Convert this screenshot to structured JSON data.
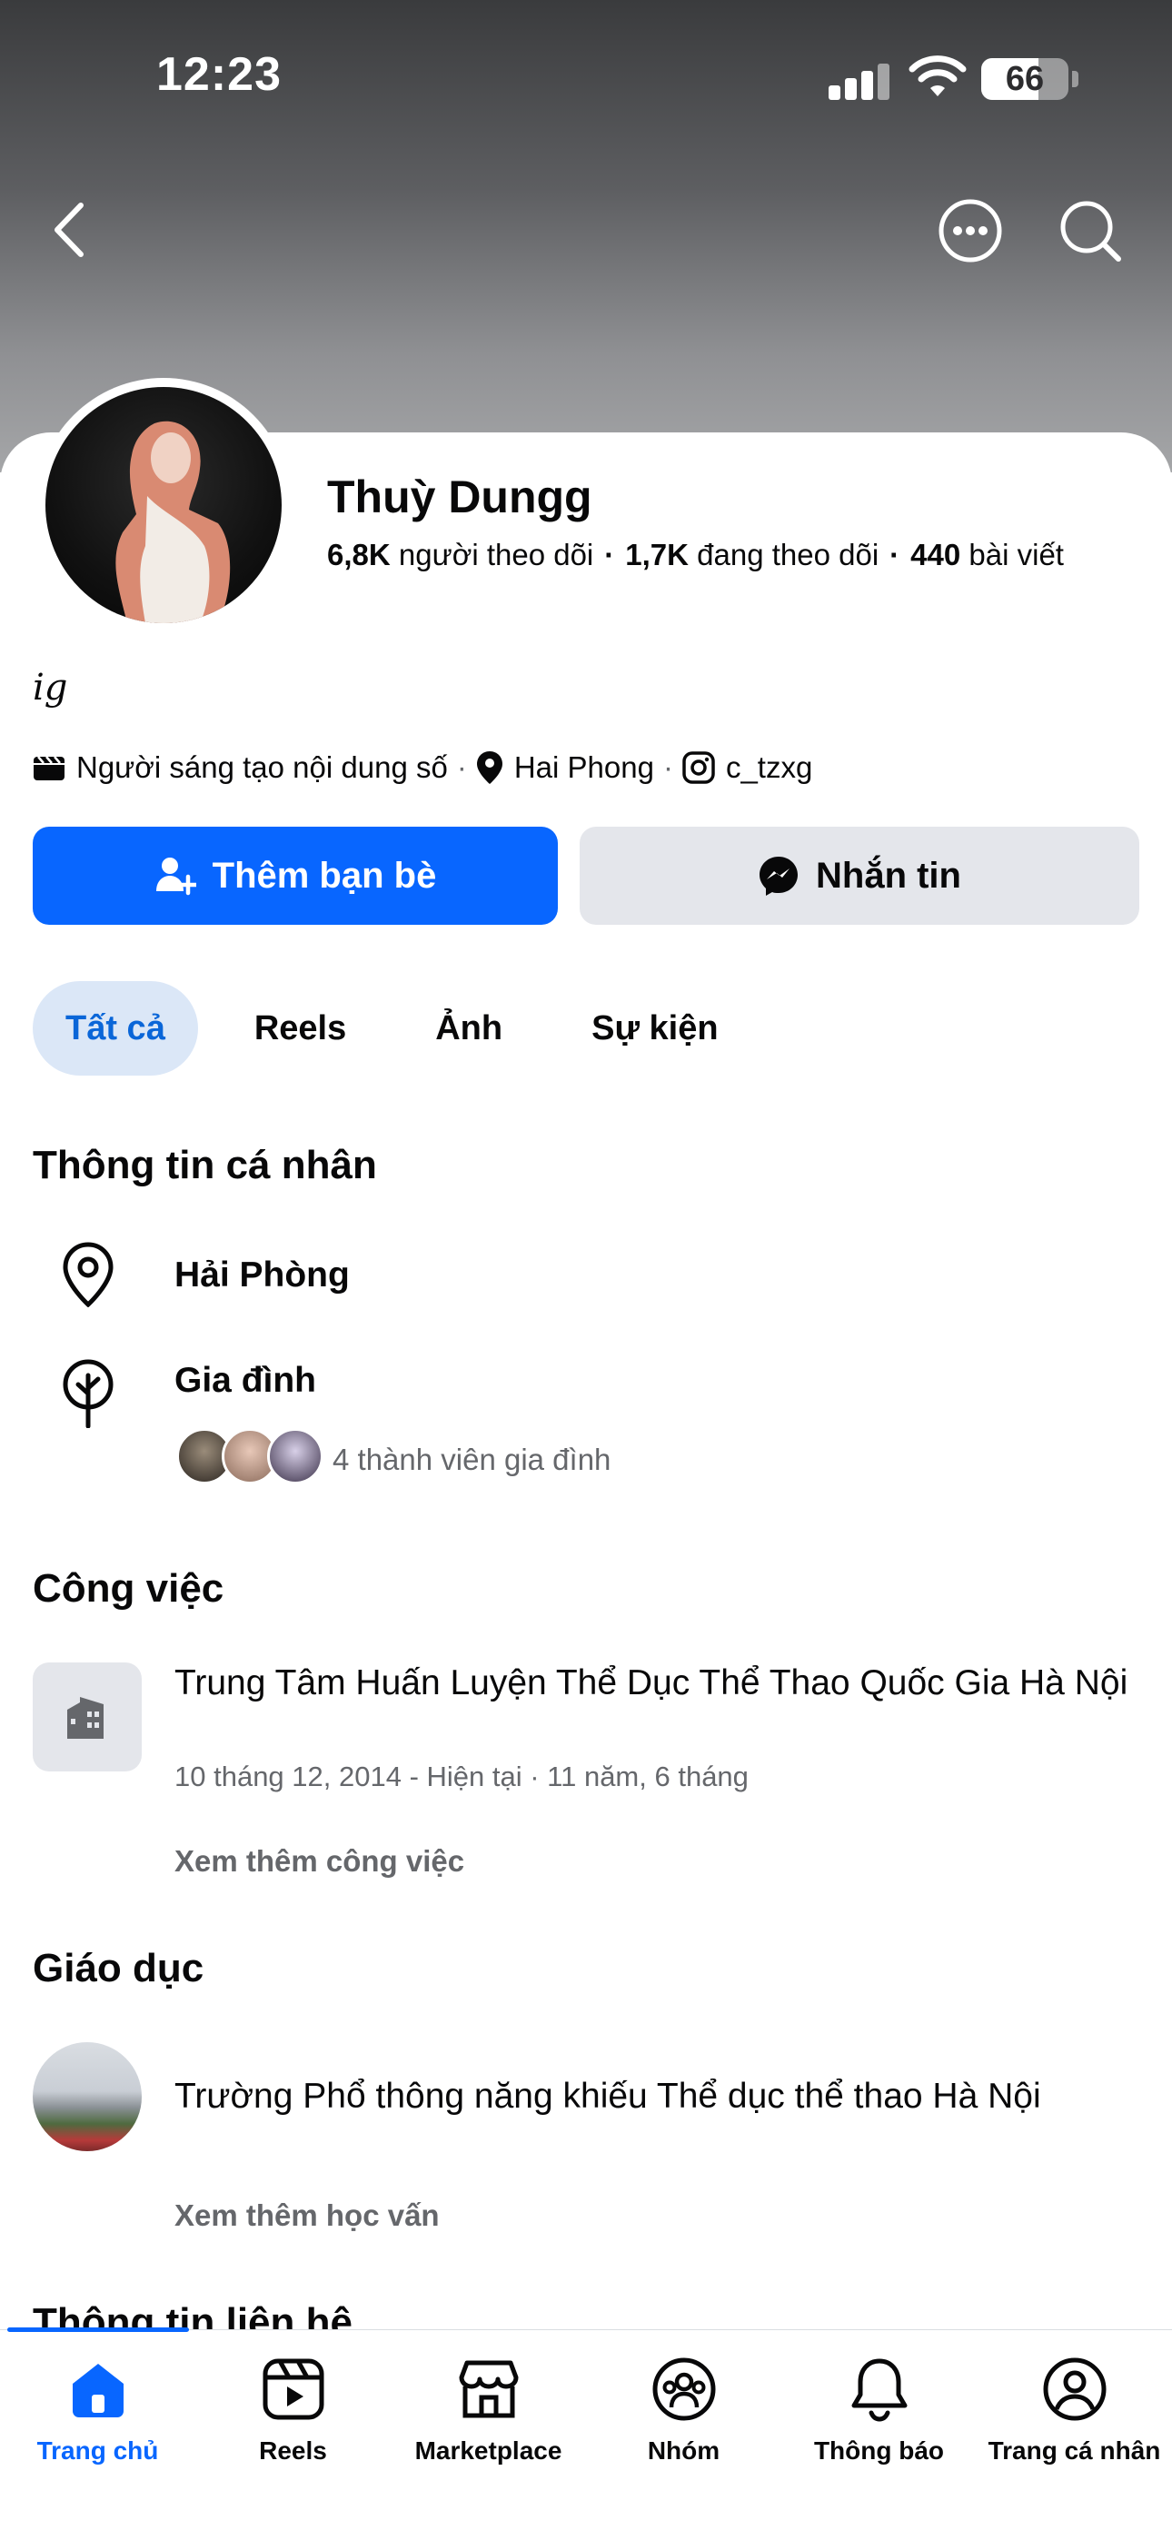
{
  "status_bar": {
    "time": "12:23",
    "battery": "66",
    "battery_level": 0.66
  },
  "profile": {
    "name": "Thuỳ Dungg",
    "followers_count": "6,8K",
    "followers_label": "người theo dõi",
    "following_count": "1,7K",
    "following_label": "đang theo dõi",
    "posts_count": "440",
    "posts_label": "bài viết",
    "bio": "ig",
    "category": "Người sáng tạo nội dung số",
    "location": "Hai Phong",
    "instagram": "c_tzxg"
  },
  "actions": {
    "add_friend": "Thêm bạn bè",
    "message": "Nhắn tin"
  },
  "tabs": [
    {
      "label": "Tất cả",
      "active": true
    },
    {
      "label": "Reels",
      "active": false
    },
    {
      "label": "Ảnh",
      "active": false
    },
    {
      "label": "Sự kiện",
      "active": false
    }
  ],
  "personal_info": {
    "title": "Thông tin cá nhân",
    "city": "Hải Phòng",
    "family_title": "Gia đình",
    "family_members": "4 thành viên gia đình"
  },
  "work": {
    "title": "Công việc",
    "employer": "Trung Tâm Huấn Luyện Thể Dục Thể Thao Quốc Gia Hà Nội",
    "period": "10 tháng 12, 2014 - Hiện tại · 11 năm, 6 tháng",
    "see_more": "Xem thêm công việc"
  },
  "education": {
    "title": "Giáo dục",
    "school": "Trường Phổ thông năng khiếu Thể dục thể thao Hà Nội",
    "see_more": "Xem thêm học vấn"
  },
  "contact": {
    "title": "Thông tin liên hệ"
  },
  "tabbar": [
    {
      "label": "Trang chủ",
      "icon": "home-icon",
      "active": true
    },
    {
      "label": "Reels",
      "icon": "reels-icon",
      "active": false
    },
    {
      "label": "Marketplace",
      "icon": "marketplace-icon",
      "active": false
    },
    {
      "label": "Nhóm",
      "icon": "groups-icon",
      "active": false
    },
    {
      "label": "Thông báo",
      "icon": "bell-icon",
      "active": false
    },
    {
      "label": "Trang cá nhân",
      "icon": "profile-icon",
      "active": false
    }
  ],
  "colors": {
    "accent": "#0866ff",
    "tab_active_bg": "#dbe7f7",
    "secondary_text": "#65676b"
  }
}
